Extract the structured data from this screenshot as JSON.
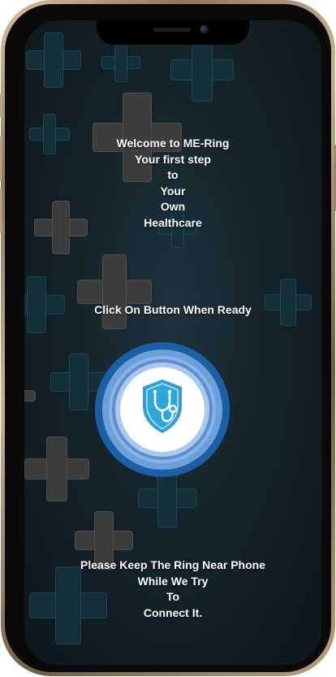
{
  "welcome": {
    "lines": [
      "Welcome to ME-Ring",
      "Your first step",
      "to",
      "Your",
      "Own",
      "Healthcare"
    ]
  },
  "instruction": "Click On Button When Ready",
  "connect_button": {
    "icon": "shield-stethoscope-icon"
  },
  "footer": {
    "lines": [
      "Please Keep The Ring Near Phone",
      "While We Try",
      "To",
      "Connect It."
    ]
  },
  "colors": {
    "background": "#132128",
    "ring_outer": "#1b5fa4",
    "ring_mid": "#6d9fd8",
    "ring_inner": "#a9c8ee",
    "icon_blue": "#2f9fd6",
    "text": "#ffffff"
  }
}
